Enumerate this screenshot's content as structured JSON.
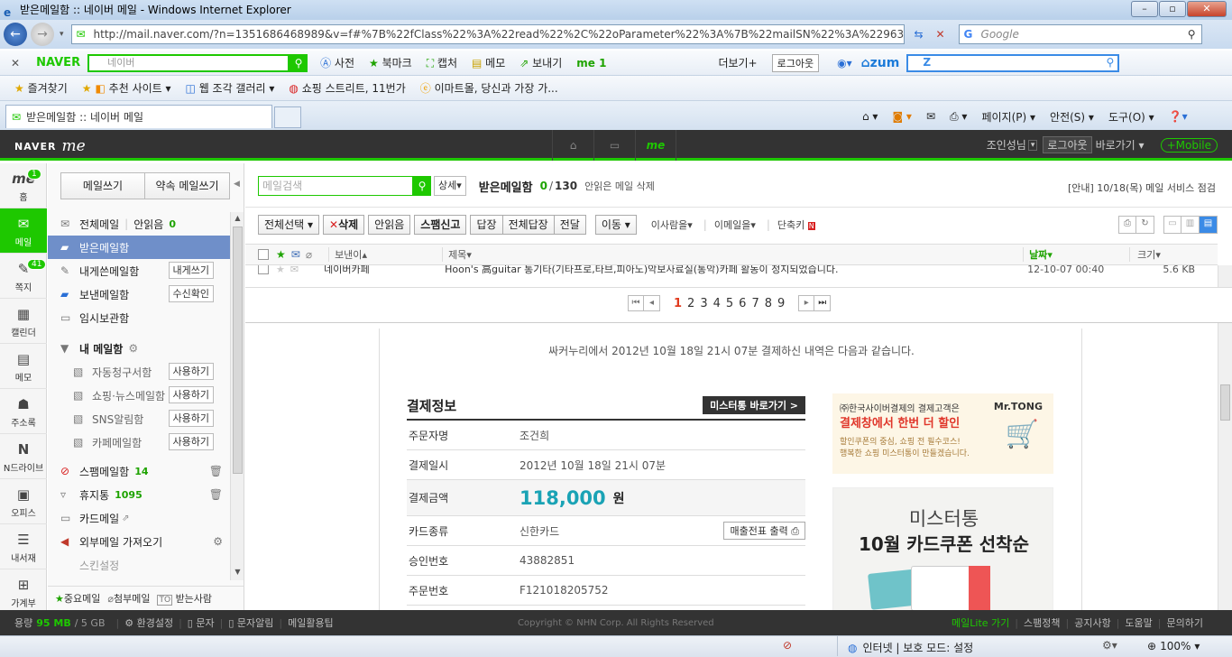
{
  "window": {
    "title": "받은메일함 :: 네이버 메일 - Windows Internet Explorer"
  },
  "address": {
    "url": "http://mail.naver.com/?n=1351686468989&v=f#%7B%22fClass%22%3A%22read%22%2C%22oParameter%22%3A%7B%22mailSN%22%3A%229634%22%2C%2",
    "search_placeholder": "Google"
  },
  "naver_toolbar": {
    "logo": "NAVER",
    "search_placeholder": "네이버",
    "items": [
      "사전",
      "북마크",
      "캡처",
      "메모",
      "보내기",
      "me 1",
      "더보기+",
      "로그아웃"
    ],
    "zum": "zum"
  },
  "favorites": {
    "label": "즐겨찾기",
    "items": [
      "추천 사이트 ▾",
      "웹 조각 갤러리 ▾",
      "쇼핑 스트리트, 11번가",
      "이마트몰, 당신과 가장 가..."
    ]
  },
  "tab": {
    "title": "받은메일함 :: 네이버 메일"
  },
  "command_bar": [
    "페이지(P) ▾",
    "안전(S) ▾",
    "도구(O) ▾"
  ],
  "me_header": {
    "logo_naver": "NAVER",
    "logo_me": "me",
    "user": "조인성님",
    "logout": "로그아웃",
    "shortcuts": "바로가기",
    "mobile": "+Mobile"
  },
  "left_nav": [
    {
      "label": "홈",
      "badge": "1"
    },
    {
      "label": "메일",
      "badge": ""
    },
    {
      "label": "쪽지",
      "badge": "41"
    },
    {
      "label": "캘린더",
      "badge": ""
    },
    {
      "label": "메모",
      "badge": ""
    },
    {
      "label": "주소록",
      "badge": ""
    },
    {
      "label": "N드라이브",
      "badge": ""
    },
    {
      "label": "오피스",
      "badge": ""
    },
    {
      "label": "내서재",
      "badge": ""
    },
    {
      "label": "가계부",
      "badge": ""
    }
  ],
  "sidebar": {
    "write": "메일쓰기",
    "promise": "약속 메일쓰기",
    "all_mail": "전체메일",
    "unread_label": "안읽음",
    "unread_count": "0",
    "inbox": "받은메일함",
    "sent_to_me": "내게쓴메일함",
    "sent_to_me_btn": "내게쓰기",
    "sent": "보낸메일함",
    "sent_btn": "수신확인",
    "drafts": "임시보관함",
    "my_box": "내 메일함",
    "my_folders": [
      {
        "name": "자동청구서함",
        "btn": "사용하기"
      },
      {
        "name": "쇼핑·뉴스메일함",
        "btn": "사용하기"
      },
      {
        "name": "SNS알림함",
        "btn": "사용하기"
      },
      {
        "name": "카페메일함",
        "btn": "사용하기"
      }
    ],
    "spam": "스팸메일함",
    "spam_count": "14",
    "trash": "휴지통",
    "trash_count": "1095",
    "card": "카드메일",
    "external": "외부메일 가져오기",
    "cut_text": "스킨설정",
    "bottom": [
      "중요메일",
      "첨부메일",
      "받는사람"
    ]
  },
  "main": {
    "search_placeholder": "메일검색",
    "detail": "상세",
    "box_title": "받은메일함",
    "unread": "0",
    "total": "130",
    "delete_unread": "안읽은 메일 삭제",
    "notice": "[안내] 10/18(목) 메일 서비스 점검",
    "toolbar": [
      "전체선택",
      "삭제",
      "안읽음",
      "스팸신고",
      "답장",
      "전체답장",
      "전달",
      "이동"
    ],
    "filters": [
      "이사람을",
      "이메일을",
      "단축키"
    ],
    "columns": {
      "sender": "보낸이",
      "subject": "제목",
      "date": "날짜",
      "size": "크기"
    },
    "row": {
      "sender": "네이버카페",
      "subject": "Hoon's 高guitar 통기타(기타프로,타브,피아노)악보사료실(통악)카페 활동이 정지되었습니다.",
      "date": "12-10-07 00:40",
      "size": "5.6 KB"
    },
    "pages": [
      "1",
      "2",
      "3",
      "4",
      "5",
      "6",
      "7",
      "8",
      "9"
    ]
  },
  "message": {
    "intro": "싸커누리에서 2012년 10월 18일 21시 07분 결제하신 내역은 다음과 같습니다.",
    "section_title": "결제정보",
    "mrtong_btn": "미스터통 바로가기 >",
    "rows": [
      {
        "k": "주문자명",
        "v": "조건희"
      },
      {
        "k": "결제일시",
        "v": "2012년 10월 18일 21시 07분"
      },
      {
        "k": "결제금액",
        "v": "118,000"
      },
      {
        "k": "카드종류",
        "v": "신한카드"
      },
      {
        "k": "승인번호",
        "v": "43882851"
      },
      {
        "k": "주문번호",
        "v": "F121018205752"
      }
    ],
    "amount_unit": "원",
    "receipt_btn": "매출전표 출력",
    "ad1_line1": "㈜한국사이버결제의 결제고객은",
    "ad1_line2": "결제창에서 한번 더 할인",
    "ad1_line3": "할인쿠폰의 중심, 쇼핑 전 필수코스!",
    "ad1_line4": "행복한 쇼핑 미스터통이 만들겠습니다.",
    "ad1_brand": "Mr.TONG",
    "ad2_line1": "미스터통",
    "ad2_line2": "10월 카드쿠폰 선착순"
  },
  "footer": {
    "capacity_label": "용량",
    "capacity_used": "95 MB",
    "capacity_total": "/ 5 GB",
    "links": [
      "환경설정",
      "문자",
      "문자알림",
      "메일활용팁"
    ],
    "copyright": "Copyright © NHN Corp. All Rights Reserved",
    "right_links": [
      "메일Lite 가기",
      "스팸정책",
      "공지사항",
      "도움말",
      "문의하기"
    ]
  },
  "status": {
    "zone": "인터넷 | 보호 모드: 설정",
    "zoom": "100%"
  }
}
